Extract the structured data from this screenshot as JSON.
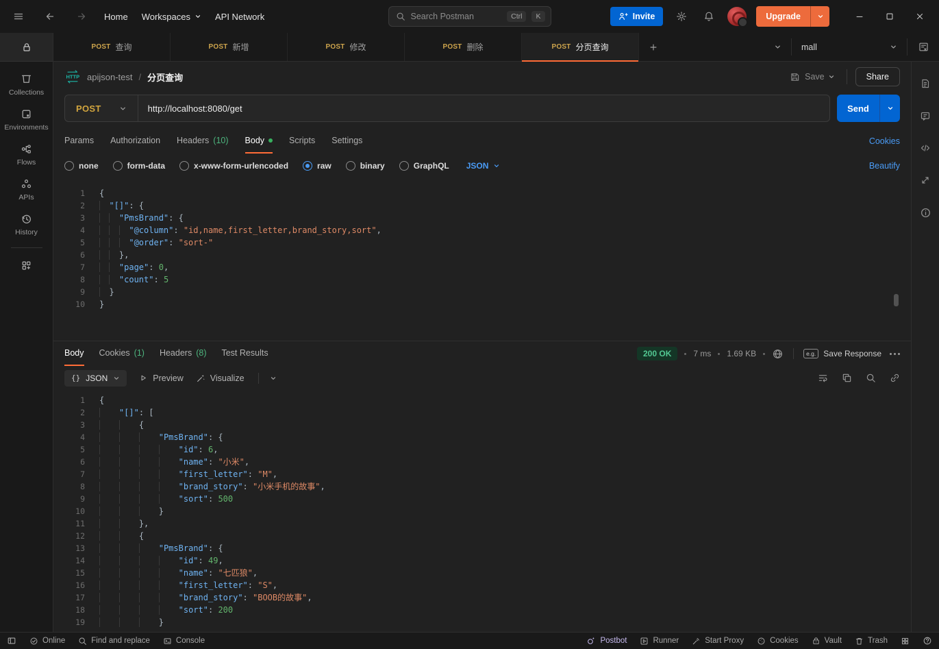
{
  "topbar": {
    "nav_home": "Home",
    "nav_workspaces": "Workspaces",
    "nav_api_network": "API Network",
    "search_placeholder": "Search Postman",
    "shortcut_ctrl": "Ctrl",
    "shortcut_k": "K",
    "invite": "Invite",
    "upgrade": "Upgrade"
  },
  "sidebar": {
    "items": [
      {
        "label": "Collections"
      },
      {
        "label": "Environments"
      },
      {
        "label": "Flows"
      },
      {
        "label": "APIs"
      },
      {
        "label": "History"
      }
    ]
  },
  "tabstrip": {
    "tabs": [
      {
        "method": "POST",
        "label": "查询"
      },
      {
        "method": "POST",
        "label": "新增"
      },
      {
        "method": "POST",
        "label": "修改"
      },
      {
        "method": "POST",
        "label": "删除"
      },
      {
        "method": "POST",
        "label": "分页查询"
      }
    ],
    "environment": "mall"
  },
  "breadcrumb": {
    "collection": "apijson-test",
    "separator": "/",
    "title": "分页查询",
    "save": "Save",
    "share": "Share"
  },
  "request": {
    "method": "POST",
    "url": "http://localhost:8080/get",
    "send": "Send",
    "tabs": [
      {
        "label": "Params"
      },
      {
        "label": "Authorization"
      },
      {
        "label": "Headers",
        "count": "(10)"
      },
      {
        "label": "Body"
      },
      {
        "label": "Scripts"
      },
      {
        "label": "Settings"
      }
    ],
    "cookies_link": "Cookies",
    "body_types": [
      {
        "label": "none"
      },
      {
        "label": "form-data"
      },
      {
        "label": "x-www-form-urlencoded"
      },
      {
        "label": "raw"
      },
      {
        "label": "binary"
      },
      {
        "label": "GraphQL"
      }
    ],
    "format": "JSON",
    "beautify": "Beautify"
  },
  "request_editor": {
    "unit": 2,
    "lines": [
      {
        "i": 0,
        "t": [
          [
            "p",
            "{"
          ]
        ]
      },
      {
        "i": 1,
        "t": [
          [
            "k",
            "\"[]\""
          ],
          [
            "p",
            ": {"
          ]
        ]
      },
      {
        "i": 2,
        "t": [
          [
            "k",
            "\"PmsBrand\""
          ],
          [
            "p",
            ": {"
          ]
        ]
      },
      {
        "i": 3,
        "t": [
          [
            "k",
            "\"@column\""
          ],
          [
            "p",
            ": "
          ],
          [
            "s",
            "\"id,name,first_letter,brand_story,sort\""
          ],
          [
            "p",
            ","
          ]
        ]
      },
      {
        "i": 3,
        "t": [
          [
            "k",
            "\"@order\""
          ],
          [
            "p",
            ": "
          ],
          [
            "s",
            "\"sort-\""
          ]
        ]
      },
      {
        "i": 2,
        "t": [
          [
            "p",
            "},"
          ]
        ]
      },
      {
        "i": 2,
        "t": [
          [
            "k",
            "\"page\""
          ],
          [
            "p",
            ": "
          ],
          [
            "n",
            "0"
          ],
          [
            "p",
            ","
          ]
        ]
      },
      {
        "i": 2,
        "t": [
          [
            "k",
            "\"count\""
          ],
          [
            "p",
            ": "
          ],
          [
            "n",
            "5"
          ]
        ]
      },
      {
        "i": 1,
        "t": [
          [
            "p",
            "}"
          ]
        ]
      },
      {
        "i": 0,
        "t": [
          [
            "p",
            "}"
          ]
        ]
      }
    ]
  },
  "response": {
    "tabs": [
      {
        "label": "Body"
      },
      {
        "label": "Cookies",
        "count": "(1)"
      },
      {
        "label": "Headers",
        "count": "(8)"
      },
      {
        "label": "Test Results"
      }
    ],
    "status": "200 OK",
    "time": "7 ms",
    "size": "1.69 KB",
    "eg": "e.g.",
    "save_response": "Save Response",
    "format_glyph": "{}",
    "format_label": "JSON",
    "preview": "Preview",
    "visualize": "Visualize"
  },
  "response_editor": {
    "unit": 4,
    "lines": [
      {
        "i": 0,
        "t": [
          [
            "p",
            "{"
          ]
        ]
      },
      {
        "i": 1,
        "t": [
          [
            "k",
            "\"[]\""
          ],
          [
            "p",
            ": ["
          ]
        ]
      },
      {
        "i": 2,
        "t": [
          [
            "p",
            "{"
          ]
        ]
      },
      {
        "i": 3,
        "t": [
          [
            "k",
            "\"PmsBrand\""
          ],
          [
            "p",
            ": {"
          ]
        ]
      },
      {
        "i": 4,
        "t": [
          [
            "k",
            "\"id\""
          ],
          [
            "p",
            ": "
          ],
          [
            "n",
            "6"
          ],
          [
            "p",
            ","
          ]
        ]
      },
      {
        "i": 4,
        "t": [
          [
            "k",
            "\"name\""
          ],
          [
            "p",
            ": "
          ],
          [
            "s",
            "\"小米\""
          ],
          [
            "p",
            ","
          ]
        ]
      },
      {
        "i": 4,
        "t": [
          [
            "k",
            "\"first_letter\""
          ],
          [
            "p",
            ": "
          ],
          [
            "s",
            "\"M\""
          ],
          [
            "p",
            ","
          ]
        ]
      },
      {
        "i": 4,
        "t": [
          [
            "k",
            "\"brand_story\""
          ],
          [
            "p",
            ": "
          ],
          [
            "s",
            "\"小米手机的故事\""
          ],
          [
            "p",
            ","
          ]
        ]
      },
      {
        "i": 4,
        "t": [
          [
            "k",
            "\"sort\""
          ],
          [
            "p",
            ": "
          ],
          [
            "n",
            "500"
          ]
        ]
      },
      {
        "i": 3,
        "t": [
          [
            "p",
            "}"
          ]
        ]
      },
      {
        "i": 2,
        "t": [
          [
            "p",
            "},"
          ]
        ]
      },
      {
        "i": 2,
        "t": [
          [
            "p",
            "{"
          ]
        ]
      },
      {
        "i": 3,
        "t": [
          [
            "k",
            "\"PmsBrand\""
          ],
          [
            "p",
            ": {"
          ]
        ]
      },
      {
        "i": 4,
        "t": [
          [
            "k",
            "\"id\""
          ],
          [
            "p",
            ": "
          ],
          [
            "n",
            "49"
          ],
          [
            "p",
            ","
          ]
        ]
      },
      {
        "i": 4,
        "t": [
          [
            "k",
            "\"name\""
          ],
          [
            "p",
            ": "
          ],
          [
            "s",
            "\"七匹狼\""
          ],
          [
            "p",
            ","
          ]
        ]
      },
      {
        "i": 4,
        "t": [
          [
            "k",
            "\"first_letter\""
          ],
          [
            "p",
            ": "
          ],
          [
            "s",
            "\"S\""
          ],
          [
            "p",
            ","
          ]
        ]
      },
      {
        "i": 4,
        "t": [
          [
            "k",
            "\"brand_story\""
          ],
          [
            "p",
            ": "
          ],
          [
            "s",
            "\"BOOB的故事\""
          ],
          [
            "p",
            ","
          ]
        ]
      },
      {
        "i": 4,
        "t": [
          [
            "k",
            "\"sort\""
          ],
          [
            "p",
            ": "
          ],
          [
            "n",
            "200"
          ]
        ]
      },
      {
        "i": 3,
        "t": [
          [
            "p",
            "}"
          ]
        ]
      }
    ]
  },
  "statusbar": {
    "online": "Online",
    "find": "Find and replace",
    "console": "Console",
    "postbot": "Postbot",
    "runner": "Runner",
    "start_proxy": "Start Proxy",
    "cookies": "Cookies",
    "vault": "Vault",
    "trash": "Trash"
  },
  "colors": {
    "accent_orange": "#ff6c37",
    "button_blue": "#0265d2",
    "link_blue": "#4a9bf5",
    "method_gold": "#cda44c",
    "count_green": "#4db57e",
    "status_green": "#52c892"
  }
}
